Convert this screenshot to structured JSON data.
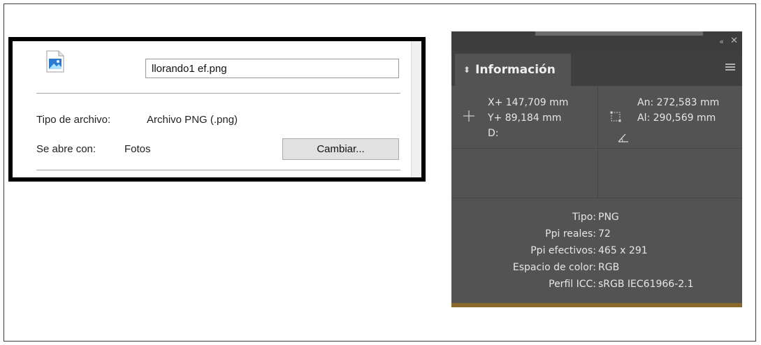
{
  "file_properties": {
    "file_name": "llorando1 ef.png",
    "file_type_label": "Tipo de archivo:",
    "file_type_value": "Archivo PNG (.png)",
    "opens_with_label": "Se abre con:",
    "opens_with_value": "Fotos",
    "change_button": "Cambiar..."
  },
  "info_panel": {
    "tab_title": "Información",
    "x": "X+ 147,709 mm",
    "y": "Y+ 89,184 mm",
    "d": "D:",
    "width": "An: 272,583 mm",
    "height": "Al: 290,569 mm",
    "rows": [
      {
        "key": "Tipo:",
        "value": "PNG"
      },
      {
        "key": "Ppi reales:",
        "value": "72"
      },
      {
        "key": "Ppi efectivos:",
        "value": "465 x 291"
      },
      {
        "key": "Espacio de color:",
        "value": "RGB"
      },
      {
        "key": "Perfil ICC:",
        "value": "sRGB IEC61966-2.1"
      }
    ]
  },
  "icons": {
    "file": "png-file-icon",
    "collapse": "double-chevron-icon",
    "close": "close-icon",
    "menu": "panel-menu-icon",
    "position": "crosshair-icon",
    "size": "bounding-box-icon",
    "angle": "angle-icon"
  }
}
